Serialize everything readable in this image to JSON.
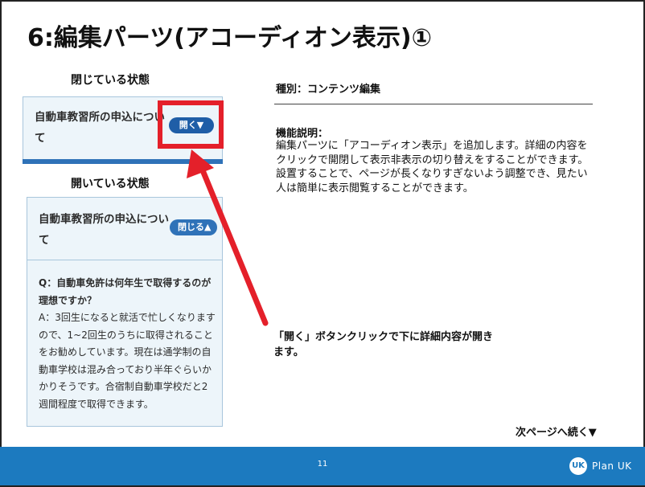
{
  "slide": {
    "title": "6:編集パーツ(アコーディオン表示)①",
    "page_number": "11"
  },
  "closed_state": {
    "label": "閉じている状態",
    "question": "自動車教習所の申込について",
    "button_label": "開く▼"
  },
  "open_state": {
    "label": "開いている状態",
    "question": "自動車教習所の申込について",
    "button_label": "閉じる▲",
    "body_question": "Q：自動車免許は何年生で取得するのが理想ですか？",
    "body_answer": "A：3回生になると就活で忙しくなりますので、1~2回生のうちに取得されることをお勧めしています。現在は通学制の自動車学校は混み合っており半年ぐらいかかりそうです。合宿制自動車学校だと2週間程度で取得できます。"
  },
  "info": {
    "kind": "種別：コンテンツ編集",
    "function_title": "機能説明：",
    "function_description": "編集パーツに「アコーディオン表示」を追加します。詳細の内容をクリックで開閉して表示非表示の切り替えをすることができます。設置することで、ページが長くなりすぎないよう調整でき、見たい人は簡単に表示閲覧することができます。"
  },
  "callout": {
    "text": "「開く」ボタンクリックで下に詳細内容が開きます。"
  },
  "footer": {
    "next_page": "次ページへ続く▼",
    "brand": "Plan UK",
    "brand_icon": "UK"
  },
  "colors": {
    "accent_red": "#e4202a",
    "button_blue": "#1f5ea7",
    "footer_blue": "#1c7abf",
    "panel_bg": "#edf5fa"
  }
}
